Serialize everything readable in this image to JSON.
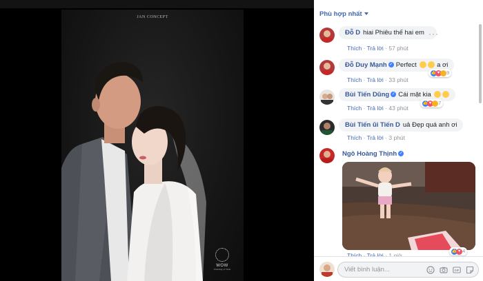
{
  "viewer": {
    "brand_text": "JAN CONCEPT",
    "watermark_word": "WOW",
    "watermark_sub": "Wedding of Wish"
  },
  "comments_panel": {
    "sort_label": "Phù hợp nhất",
    "composer_placeholder": "Viết bình luận...",
    "comments": [
      {
        "name": "Đỗ D",
        "text": "hiai Phiêu thế hai em",
        "like": "Thích",
        "reply": "Trả lời",
        "time": "57 phút"
      },
      {
        "name": "Đỗ Duy Mạnh",
        "text": "Perfect",
        "text_suffix": "a ơi",
        "like": "Thích",
        "reply": "Trả lời",
        "time": "33 phút",
        "reactions": "9"
      },
      {
        "name": "Bùi Tiến Dũng",
        "text": "Cái mặt kia",
        "like": "Thích",
        "reply": "Trả lời",
        "time": "43 phút",
        "reactions": "7"
      },
      {
        "name": "Bùi Tiến ũi Tiến D",
        "text": "uả Đẹp quá anh ơi",
        "like": "Thích",
        "reply": "Trả lời",
        "time": "3 phút"
      },
      {
        "name": "Ngô Hoàng Thịnh",
        "like": "Thích",
        "reply": "Trả lời",
        "time": "1 giờ",
        "reactions": "4"
      }
    ]
  },
  "colors": {
    "fb_blue": "#4267b2",
    "name_blue": "#385898",
    "bubble_bg": "#f2f3f5"
  }
}
